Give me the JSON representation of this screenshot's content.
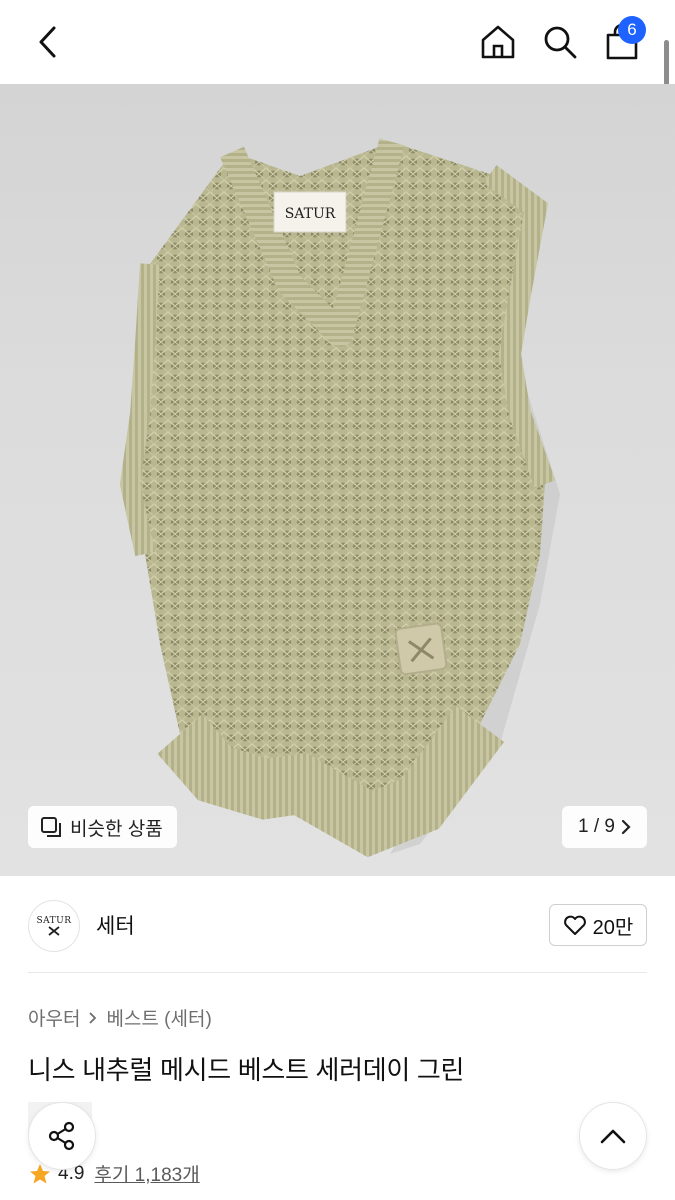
{
  "header": {
    "back_icon": "chevron-left-icon",
    "home_icon": "home-icon",
    "search_icon": "search-icon",
    "cart_icon": "shopping-bag-icon",
    "cart_count": "6",
    "badge_color": "#1e63ff"
  },
  "hero": {
    "similar_label": "비슷한 상품",
    "similar_icon": "similar-items-icon",
    "pager_text": "1 / 9",
    "pager_icon": "chevron-right-icon",
    "garment_label_text": "SATUR"
  },
  "brand": {
    "name": "세터",
    "logo_text": "SATUR",
    "like_icon": "heart-icon",
    "like_count": "20만"
  },
  "product": {
    "breadcrumb": [
      "아우터",
      "베스트 (세터)"
    ],
    "title": "니스 내추럴 메시드 베스트 세러데이 그린",
    "rating": "4.9",
    "reviews_label": "후기 1,183개",
    "star_color": "#f5a623"
  },
  "floating": {
    "share_icon": "share-icon",
    "top_icon": "chevron-up-icon"
  }
}
